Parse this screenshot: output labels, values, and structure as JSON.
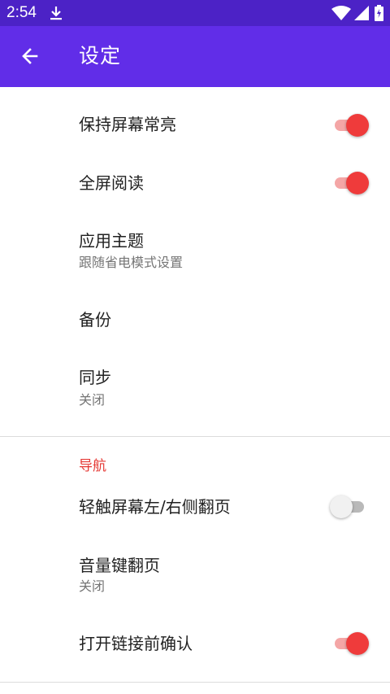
{
  "status_bar": {
    "time": "2:54",
    "icons": [
      "download-icon",
      "wifi-icon",
      "signal-icon",
      "battery-charging-icon"
    ]
  },
  "app_bar": {
    "back_icon": "arrow-back-icon",
    "title": "设定"
  },
  "settings": {
    "keep_screen_on": {
      "title": "保持屏幕常亮",
      "enabled": true
    },
    "fullscreen_reading": {
      "title": "全屏阅读",
      "enabled": true
    },
    "app_theme": {
      "title": "应用主题",
      "summary": "跟随省电模式设置"
    },
    "backup": {
      "title": "备份"
    },
    "sync": {
      "title": "同步",
      "summary": "关闭"
    }
  },
  "navigation_section": {
    "header": "导航",
    "tap_side_page_turn": {
      "title": "轻触屏幕左/右侧翻页",
      "enabled": false
    },
    "volume_key_page_turn": {
      "title": "音量键翻页",
      "summary": "关闭"
    },
    "confirm_open_link": {
      "title": "打开链接前确认",
      "enabled": true
    }
  },
  "colors": {
    "status_bar": "#4c22c6",
    "app_bar": "#612de8",
    "accent": "#ef3b3b",
    "section_header": "#e53935"
  }
}
